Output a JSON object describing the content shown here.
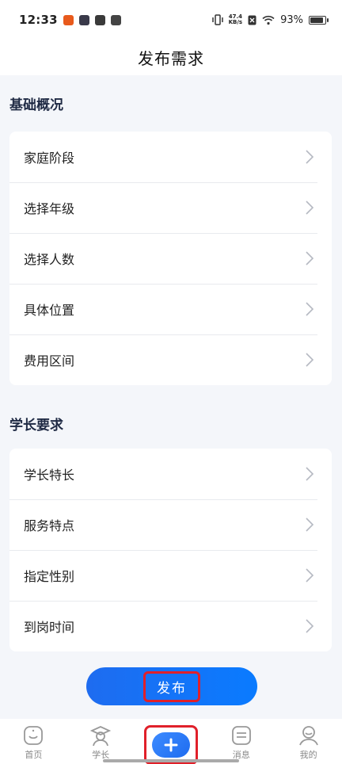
{
  "status_bar": {
    "time": "12:33",
    "net_speed_value": "47.4",
    "net_speed_unit": "KB/s",
    "battery": "93%",
    "battery_level": 0.93
  },
  "nav": {
    "title": "发布需求"
  },
  "basic": {
    "title": "基础概况",
    "items": [
      "家庭阶段",
      "选择年级",
      "选择人数",
      "具体位置",
      "费用区间"
    ]
  },
  "senior": {
    "title": "学长要求",
    "items": [
      "学长特长",
      "服务特点",
      "指定性别",
      "到岗时间"
    ]
  },
  "publish_label": "发布",
  "tabs": [
    {
      "label": "首页",
      "icon": "smile-home-icon"
    },
    {
      "label": "学长",
      "icon": "graduate-icon"
    },
    {
      "label": "",
      "icon": "plus-icon"
    },
    {
      "label": "消息",
      "icon": "message-icon"
    },
    {
      "label": "我的",
      "icon": "profile-icon"
    }
  ],
  "colors": {
    "accent": "#1e6cf0",
    "highlight": "#e0202a"
  }
}
